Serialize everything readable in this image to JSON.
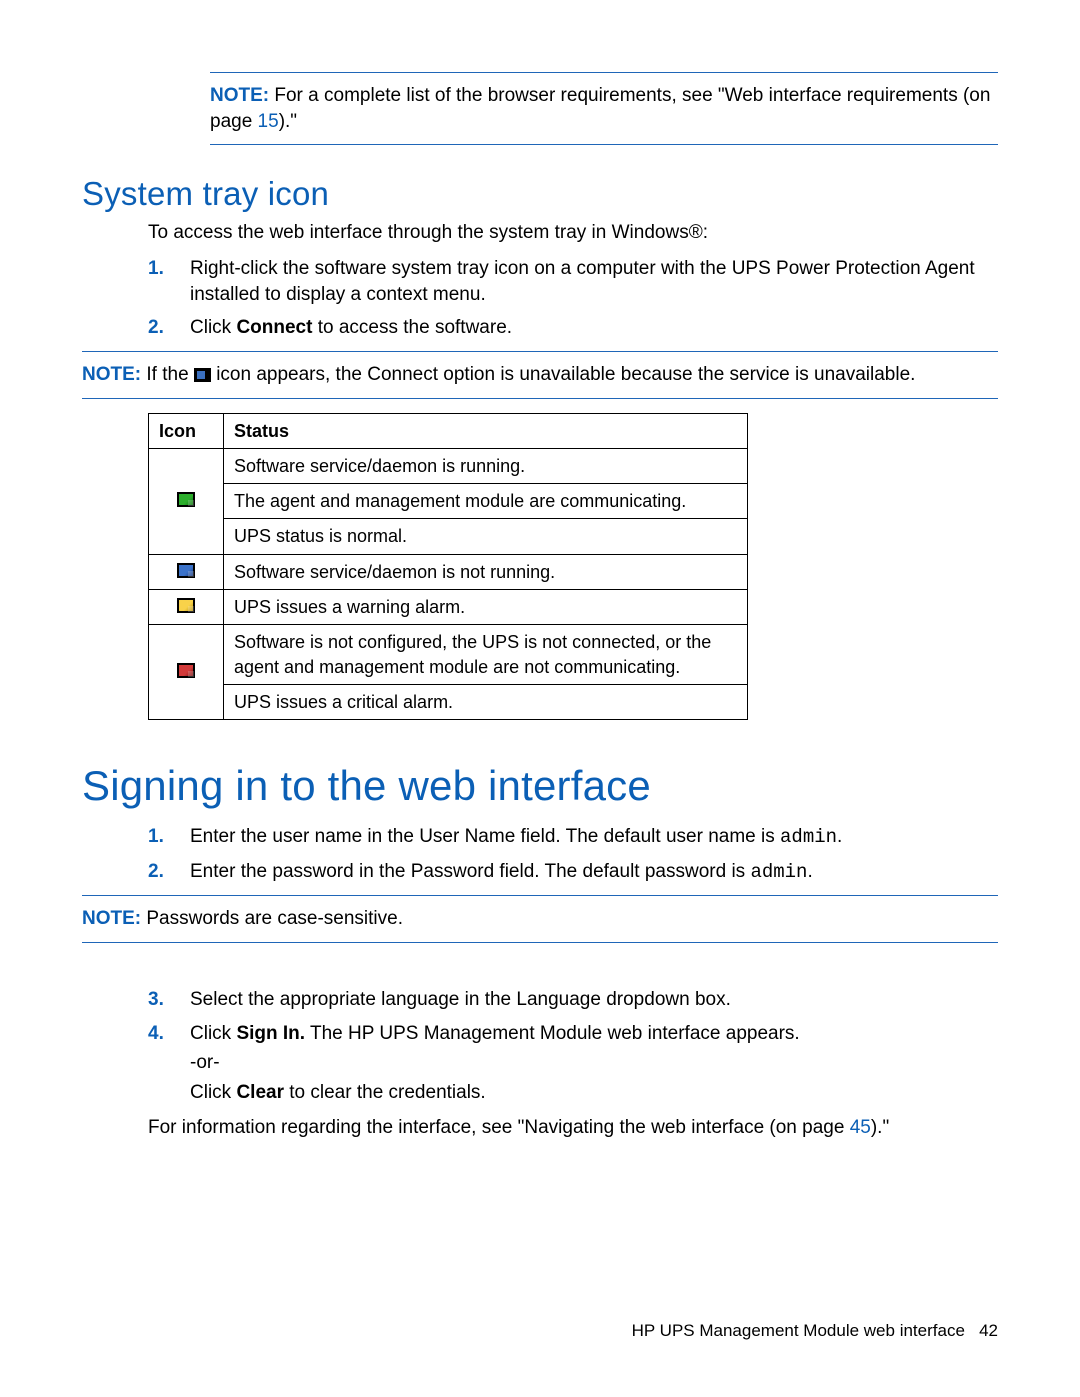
{
  "topNote": {
    "label": "NOTE:",
    "before": "  For a complete list of the browser requirements, see \"Web interface requirements (on page ",
    "link": "15",
    "after": ").\""
  },
  "sysTray": {
    "heading": "System tray icon",
    "intro": "To access the web interface through the system tray in Windows®:",
    "steps": [
      {
        "n": "1.",
        "t": "Right-click the software system tray icon on a computer with the UPS Power Protection Agent installed to display a context menu."
      },
      {
        "n": "2.",
        "pre": "Click ",
        "bold": "Connect",
        "post": " to access the software."
      }
    ],
    "subNote": {
      "label": "NOTE:",
      "before": "  If the ",
      "after": " icon appears, the Connect option is unavailable because the service is unavailable."
    },
    "table": {
      "hIcon": "Icon",
      "hStatus": "Status",
      "rows": [
        {
          "icon": "green",
          "lines": [
            "Software service/daemon is running.",
            "The agent and management module are communicating.",
            "UPS status is normal."
          ]
        },
        {
          "icon": "blue",
          "lines": [
            "Software service/daemon is not running."
          ]
        },
        {
          "icon": "yellow",
          "lines": [
            "UPS issues a warning alarm."
          ]
        },
        {
          "icon": "red",
          "lines": [
            "Software is not configured, the UPS is not connected, or the agent and management module are not communicating.",
            "UPS issues a critical alarm."
          ]
        }
      ]
    }
  },
  "signIn": {
    "heading": "Signing in to the web interface",
    "steps12": [
      {
        "n": "1.",
        "pre": "Enter the user name in the User Name field. The default user name is ",
        "mono": "admin",
        "post": "."
      },
      {
        "n": "2.",
        "pre": "Enter the password in the Password field. The default password is ",
        "mono": "admin",
        "post": "."
      }
    ],
    "pwNote": {
      "label": "NOTE:",
      "text": "  Passwords are case-sensitive."
    },
    "steps3": {
      "n": "3.",
      "t": "Select the appropriate language in the Language dropdown box."
    },
    "steps4": {
      "n": "4.",
      "l1pre": "Click ",
      "l1bold": "Sign In.",
      "l1post": " The HP UPS Management Module web interface appears.",
      "l2": "-or-",
      "l3pre": "Click ",
      "l3bold": "Clear",
      "l3post": " to clear the credentials."
    },
    "outroPre": "For information regarding the interface, see \"Navigating the web interface (on page ",
    "outroLink": "45",
    "outroPost": ").\""
  },
  "footer": {
    "title": "HP UPS Management Module web interface",
    "page": "42"
  }
}
